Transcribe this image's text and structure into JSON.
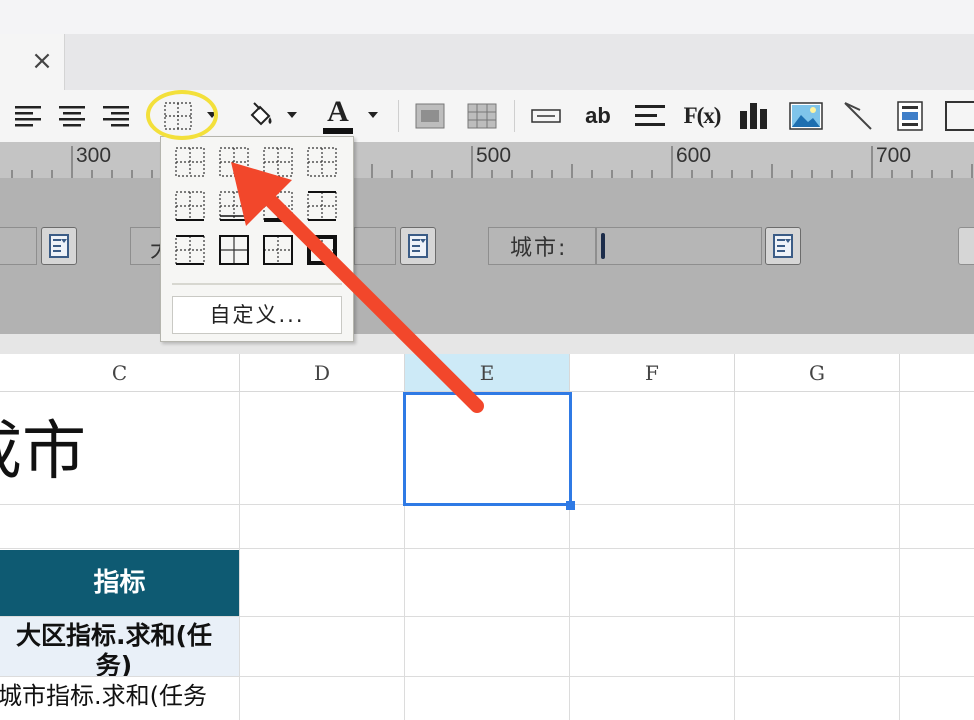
{
  "tab": {
    "close_glyph": "×"
  },
  "toolbar": {
    "icons": [
      "align-left-icon",
      "align-center-icon",
      "align-right-icon",
      "border-icon",
      "fill-color-icon",
      "font-color-icon",
      "merge-cells-icon",
      "unmerge-cells-icon",
      "textbox-icon",
      "text-icon",
      "paragraph-icon",
      "formula-icon",
      "chart-icon",
      "image-icon",
      "slash-icon",
      "subreport-icon",
      "frame-icon"
    ],
    "text_label": "ab",
    "font_color_glyph": "A",
    "formula_label": "F(x)"
  },
  "ruler": {
    "labels": [
      "300",
      "500",
      "600",
      "700"
    ]
  },
  "params": {
    "daqu_label_partial": "大",
    "city_label": "城市:"
  },
  "border_menu": {
    "custom_label": "自定义..."
  },
  "columns": [
    "C",
    "D",
    "E",
    "F",
    "G"
  ],
  "sheet": {
    "title_partial": "成市",
    "header": "指标",
    "row1": "大区指标.求和(任务)",
    "row2": "城市指标.求和(任务"
  },
  "colors": {
    "accent_selection": "#2f7ae5",
    "header_fill": "#0e5a72",
    "annotation_circle": "#f3e03b",
    "annotation_arrow": "#f2472b"
  }
}
